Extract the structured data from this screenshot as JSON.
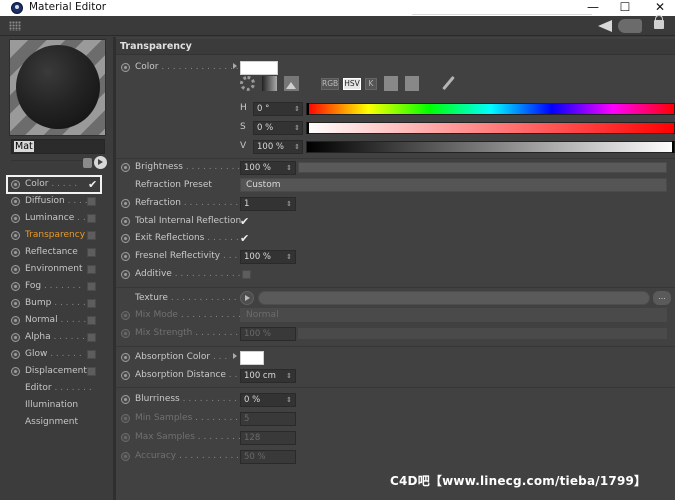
{
  "window": {
    "title": "Material Editor",
    "minimize": "—",
    "maximize": "☐",
    "close": "✕"
  },
  "preview": {
    "material_name": "Mat"
  },
  "channels": [
    {
      "label": "Color",
      "dots": " . . . . . ",
      "checked": true,
      "selected": true
    },
    {
      "label": "Diffusion",
      "dots": " . . . . ",
      "checked": false
    },
    {
      "label": "Luminance",
      "dots": " . . ",
      "checked": false
    },
    {
      "label": "Transparency",
      "dots": "",
      "checked": false,
      "active": true
    },
    {
      "label": "Reflectance",
      "dots": "",
      "checked": false
    },
    {
      "label": "Environment",
      "dots": "",
      "checked": false
    },
    {
      "label": "Fog",
      "dots": " . . . . . . . ",
      "checked": false
    },
    {
      "label": "Bump",
      "dots": " . . . . . . ",
      "checked": false
    },
    {
      "label": "Normal",
      "dots": " . . . . . ",
      "checked": false
    },
    {
      "label": "Alpha",
      "dots": " . . . . . . ",
      "checked": false
    },
    {
      "label": "Glow",
      "dots": " . . . . . . ",
      "checked": false
    },
    {
      "label": "Displacement",
      "dots": "",
      "checked": false
    },
    {
      "label": "Editor",
      "dots": " . . . . . . . ",
      "plain": true
    },
    {
      "label": "Illumination",
      "dots": "",
      "plain": true
    },
    {
      "label": "Assignment",
      "dots": "",
      "plain": true
    }
  ],
  "section": {
    "title": "Transparency"
  },
  "color": {
    "label": "Color",
    "dots": " . . . . . . . . . . . . . .",
    "swatch": "#ffffff",
    "mode_buttons": {
      "rgb": "RGB",
      "hsv": "HSV",
      "k": "K"
    },
    "h": {
      "key": "H",
      "value": "0 °"
    },
    "s": {
      "key": "S",
      "value": "0 %"
    },
    "v": {
      "key": "V",
      "value": "100 %"
    }
  },
  "params": {
    "brightness": {
      "label": "Brightness",
      "dots": " . . . . . . . . . . . . . .",
      "value": "100 %"
    },
    "refraction_preset": {
      "label": "Refraction Preset",
      "value": "Custom"
    },
    "refraction": {
      "label": "Refraction",
      "dots": " . . . . . . . . . . . . . . .",
      "value": "1"
    },
    "total_internal_reflection": {
      "label": "Total Internal Reflection",
      "checked": "✔"
    },
    "exit_reflections": {
      "label": "Exit Reflections",
      "dots": " . . . . . . . .",
      "checked": "✔"
    },
    "fresnel_reflectivity": {
      "label": "Fresnel Reflectivity",
      "dots": " . . . .",
      "value": "100 %"
    },
    "additive": {
      "label": "Additive",
      "dots": " . . . . . . . . . . . . . . ."
    },
    "texture": {
      "label": "Texture",
      "dots": " . . . . . . . . . . . . . . . .",
      "more": "..."
    },
    "mix_mode": {
      "label": "Mix Mode",
      "dots": " . . . . . . . . . . . . .",
      "value": "Normal"
    },
    "mix_strength": {
      "label": "Mix Strength",
      "dots": " . . . . . . . . . .",
      "value": "100 %"
    },
    "absorption_color": {
      "label": "Absorption Color",
      "dots": " . . .",
      "swatch": "#ffffff"
    },
    "absorption_distance": {
      "label": "Absorption Distance",
      "dots": " . . .",
      "value": "100 cm"
    },
    "blurriness": {
      "label": "Blurriness",
      "dots": " . . . . . . . . . . . . . .",
      "value": "0 %"
    },
    "min_samples": {
      "label": "Min Samples",
      "dots": " . . . . . . . . . . .",
      "value": "5"
    },
    "max_samples": {
      "label": "Max Samples",
      "dots": " . . . . . . . . . .",
      "value": "128"
    },
    "accuracy": {
      "label": "Accuracy",
      "dots": " . . . . . . . . . . . . . .",
      "value": "50 %"
    }
  },
  "watermark": "C4D吧【www.linecg.com/tieba/1799】"
}
